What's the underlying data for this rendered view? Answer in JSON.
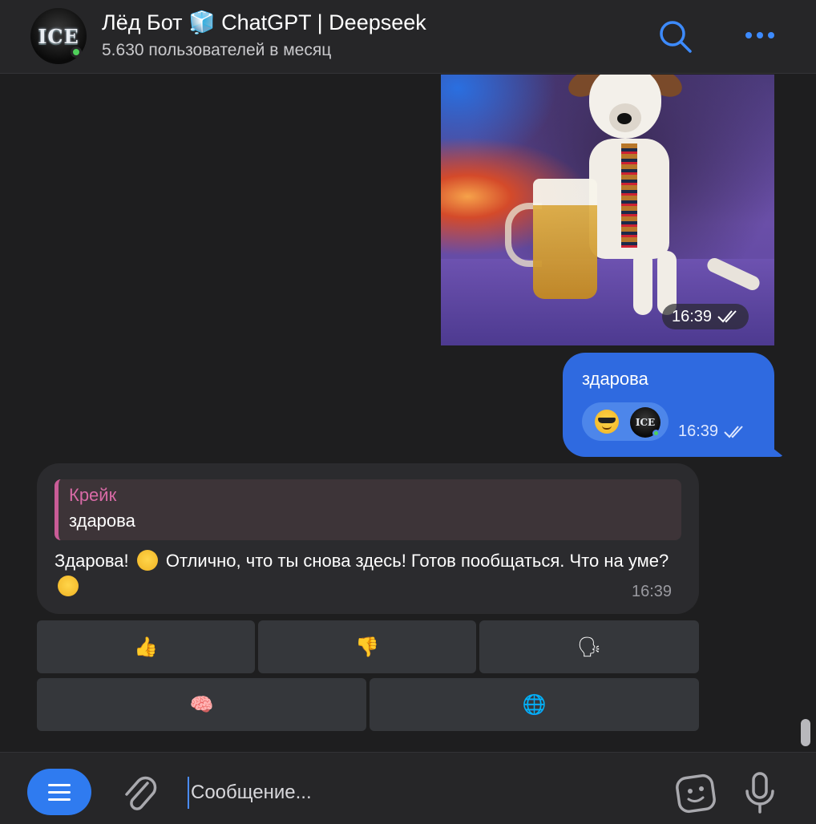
{
  "header": {
    "avatar_text": "ICE",
    "title": "Лёд Бот 🧊 ChatGPT | Deepseek",
    "subtitle": "5.630 пользователей в месяц",
    "accent": "#3d8bff"
  },
  "messages": {
    "photo_time": "16:39",
    "outgoing": {
      "text": "здарова",
      "time": "16:39",
      "reaction_avatar_text": "ICE",
      "bubble_color": "#2f6ae0"
    },
    "incoming": {
      "reply_name": "Крейк",
      "reply_text": "здарова",
      "text_part1": "Здарова! ",
      "text_part2": " Отлично, что ты снова здесь! Готов пообщаться. Что на уме? ",
      "time": "16:39"
    }
  },
  "keyboard": {
    "buttons": [
      {
        "icon": "thumbs-up-icon",
        "glyph": "👍"
      },
      {
        "icon": "thumbs-down-icon",
        "glyph": "👎"
      },
      {
        "icon": "speaking-head-icon",
        "glyph": "🗣"
      },
      {
        "icon": "brain-icon",
        "glyph": "🧠"
      },
      {
        "icon": "globe-icon",
        "glyph": "🌐"
      }
    ]
  },
  "composer": {
    "placeholder": "Сообщение..."
  }
}
